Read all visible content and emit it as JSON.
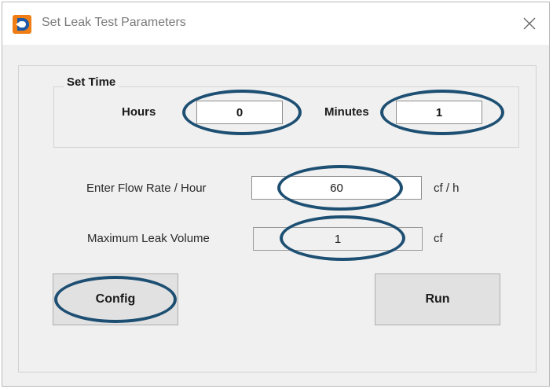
{
  "window": {
    "title": "Set Leak Test Parameters",
    "icon": "app-logo-icon",
    "close_icon": "close-icon"
  },
  "set_time": {
    "group_title": "Set Time",
    "hours_label": "Hours",
    "hours_value": "0",
    "minutes_label": "Minutes",
    "minutes_value": "1"
  },
  "flow_rate": {
    "label": "Enter Flow Rate / Hour",
    "value": "60",
    "unit": "cf / h"
  },
  "leak_volume": {
    "label": "Maximum Leak Volume",
    "value": "1",
    "unit": "cf"
  },
  "buttons": {
    "config_label": "Config",
    "run_label": "Run"
  },
  "colors": {
    "highlight": "#1d4f73",
    "app_icon_orange": "#f07d14",
    "app_icon_blue": "#1e5aa8"
  }
}
